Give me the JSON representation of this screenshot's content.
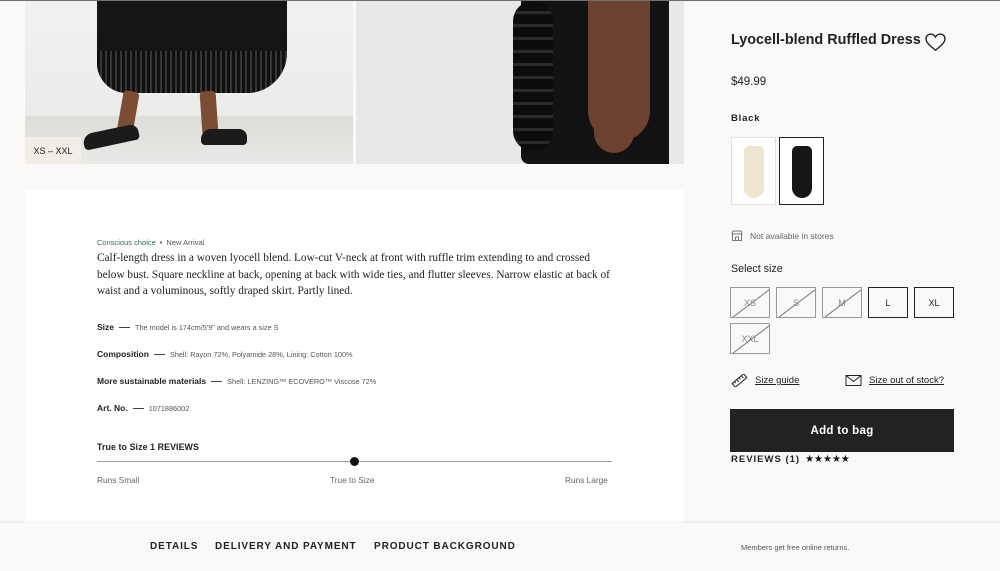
{
  "gallery": {
    "size_range_badge": "XS – XXL"
  },
  "details": {
    "tag_conscious": "Conscious choice",
    "tag_separator": "•",
    "tag_new": "New Arrival",
    "description": "Calf-length dress in a woven lyocell blend. Low-cut V-neck at front with ruffle trim extending to and crossed below bust. Square neckline at back, opening at back with wide ties, and flutter sleeves. Narrow elastic at back of waist and a voluminous, softly draped skirt. Partly lined.",
    "specs": [
      {
        "label": "Size",
        "value": "The model is 174cm/5'9\" and wears a size S"
      },
      {
        "label": "Composition",
        "value": "Shell: Rayon 72%, Polyamide 28%, Lining: Cotton 100%"
      },
      {
        "label": "More sustainable materials",
        "value": "Shell: LENZING™ ECOVERO™ Viscose 72%"
      },
      {
        "label": "Art. No.",
        "value": "1071886002"
      }
    ],
    "fit": {
      "title": "True to Size 1 REVIEWS",
      "level": 0.5,
      "scale_left": "Runs Small",
      "scale_center": "True to Size",
      "scale_right": "Runs Large"
    }
  },
  "bottom_bar": {
    "tabs": [
      "DETAILS",
      "DELIVERY AND PAYMENT",
      "PRODUCT BACKGROUND"
    ],
    "returns_note": "Members get free online returns."
  },
  "product": {
    "title": "Lyocell-blend Ruffled Dress",
    "price": "$49.99",
    "selected_color": "Black",
    "color_swatches": [
      {
        "name": "cream",
        "color": "#efe6cf",
        "selected": false
      },
      {
        "name": "black",
        "color": "#161616",
        "selected": true
      }
    ],
    "availability": "Not available in stores",
    "select_size_label": "Select size",
    "sizes": [
      {
        "label": "XS",
        "sold_out": true
      },
      {
        "label": "S",
        "sold_out": true
      },
      {
        "label": "M",
        "sold_out": true
      },
      {
        "label": "L",
        "sold_out": false
      },
      {
        "label": "XL",
        "sold_out": false
      },
      {
        "label": "XXL",
        "sold_out": true
      }
    ],
    "size_guide_link": "Size guide",
    "out_of_stock_link": "Size out of stock?",
    "add_to_bag": "Add to bag",
    "reviews_label": "REVIEWS (1)",
    "rating_stars": "★★★★★",
    "rating": 5
  },
  "icons": [
    "heart-icon",
    "store-icon",
    "ruler-icon",
    "envelope-icon",
    "star-icon"
  ]
}
